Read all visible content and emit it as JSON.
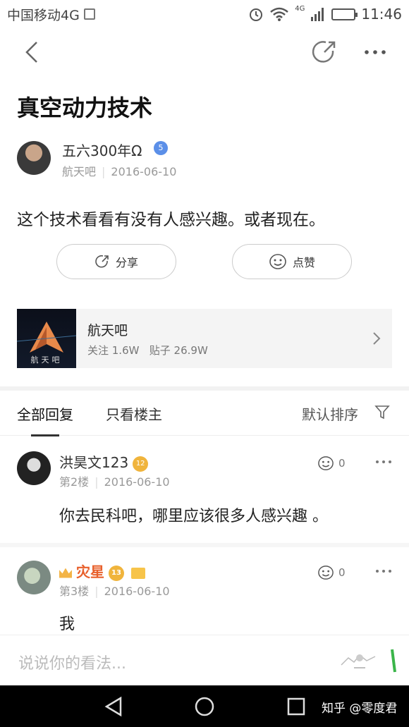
{
  "status_bar": {
    "carrier": "中国移动4G",
    "network": "4G",
    "time": "11:46"
  },
  "post": {
    "title": "真空动力技术",
    "author": {
      "name": "五六300年Ω",
      "level": "5",
      "forum": "航天吧",
      "date": "2016-06-10"
    },
    "content": "这个技术看看有没有人感兴趣。或者现在。"
  },
  "actions": {
    "share_label": "分享",
    "like_label": "点赞"
  },
  "forum_card": {
    "name": "航天吧",
    "logo_text": "航天吧",
    "followers": "关注 1.6W",
    "posts": "贴子 26.9W"
  },
  "tabs": {
    "all": "全部回复",
    "owner": "只看楼主",
    "sort": "默认排序"
  },
  "replies": [
    {
      "name": "洪昊文123",
      "level": "12",
      "floor": "第2楼",
      "date": "2016-06-10",
      "text": "你去民科吧，哪里应该很多人感兴趣 。",
      "likes": "0"
    },
    {
      "name": "灾星",
      "level": "13",
      "floor": "第3楼",
      "date": "2016-06-10",
      "text": "我",
      "likes": "0"
    }
  ],
  "comment_bar": {
    "placeholder": "说说你的看法..."
  },
  "watermark": "知乎 @零度君",
  "colors": {
    "accent_orange": "#e8602c",
    "badge_blue": "#5b8fe8",
    "level_gold": "#f0b43c"
  }
}
